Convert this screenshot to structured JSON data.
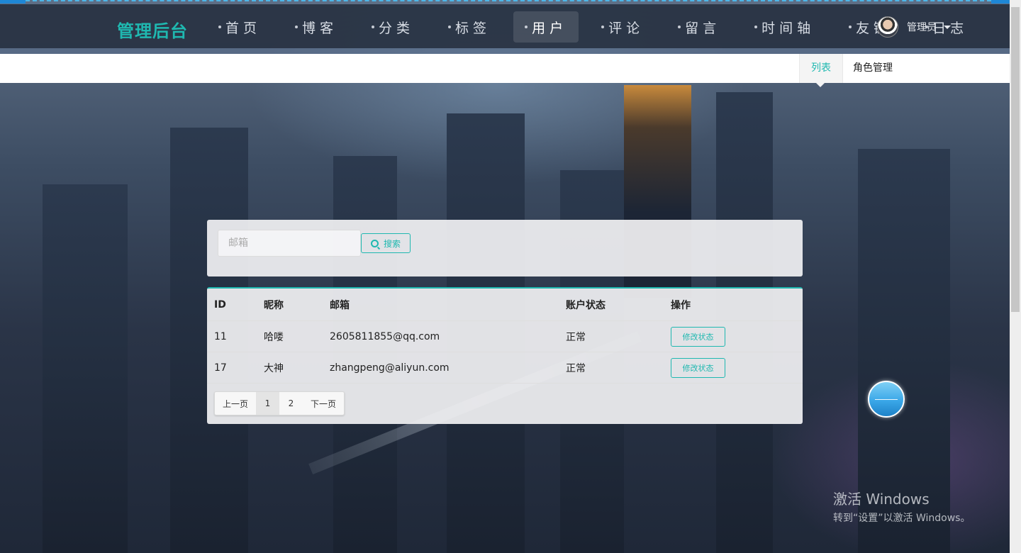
{
  "nav": {
    "brand": "管理后台",
    "items": [
      {
        "label": "首页"
      },
      {
        "label": "博客"
      },
      {
        "label": "分类"
      },
      {
        "label": "标签"
      },
      {
        "label": "用户"
      },
      {
        "label": "评论"
      },
      {
        "label": "留言"
      },
      {
        "label": "时间轴"
      },
      {
        "label": "友链"
      },
      {
        "label": "日志"
      }
    ],
    "active": "用户",
    "user_name": "管理员"
  },
  "subnav": {
    "list_label": "列表",
    "role_label": "角色管理"
  },
  "search": {
    "placeholder": "邮箱",
    "button_label": "搜索"
  },
  "table": {
    "columns": [
      "ID",
      "昵称",
      "邮箱",
      "账户状态",
      "操作"
    ],
    "rows": [
      {
        "id": "11",
        "nickname": "哈喽",
        "email": "2605811855@qq.com",
        "status": "正常",
        "action": "修改状态"
      },
      {
        "id": "17",
        "nickname": "大神",
        "email": "zhangpeng@aliyun.com",
        "status": "正常",
        "action": "修改状态"
      }
    ]
  },
  "pagination": {
    "prev": "上一页",
    "pages": [
      "1",
      "2"
    ],
    "current": "1",
    "next": "下一页"
  },
  "watermark": {
    "line1": "激活 Windows",
    "line2": "转到“设置”以激活 Windows。"
  },
  "colors": {
    "accent": "#1fb8b0",
    "navbar": "#283242"
  }
}
